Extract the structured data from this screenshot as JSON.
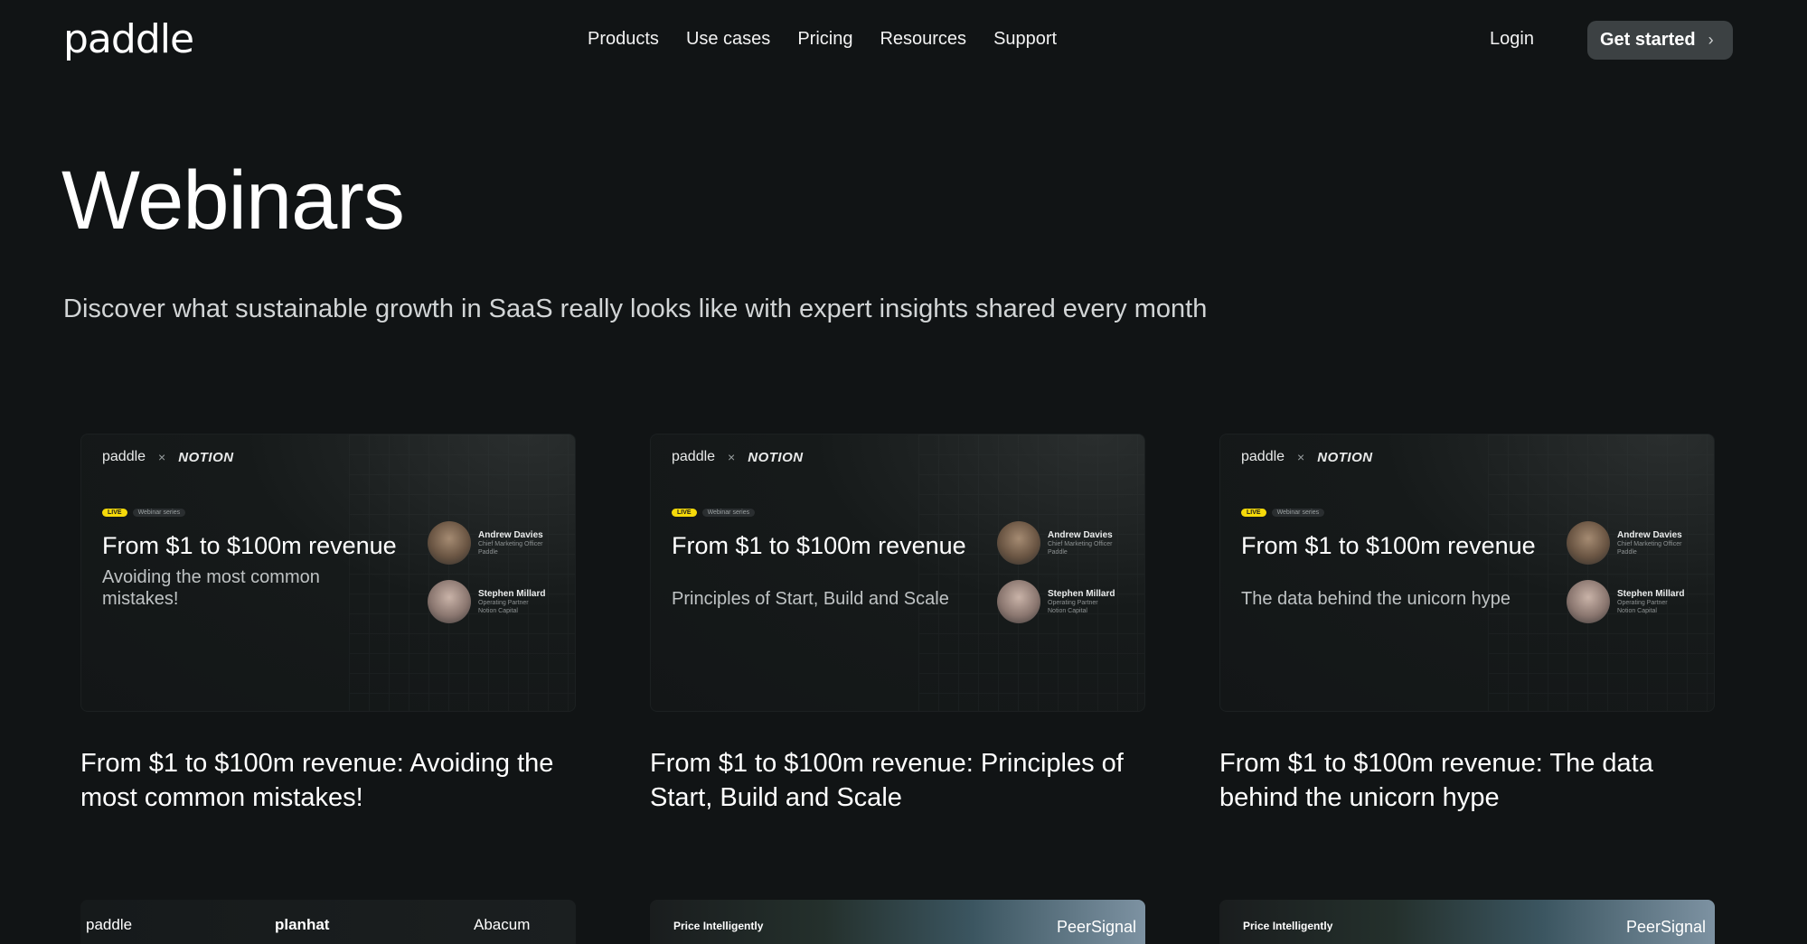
{
  "nav": {
    "logo": "paddle",
    "links": [
      "Products",
      "Use cases",
      "Pricing",
      "Resources",
      "Support"
    ],
    "login": "Login",
    "cta": "Get started"
  },
  "hero": {
    "title": "Webinars",
    "subtitle": "Discover what sustainable growth in SaaS really looks like with expert insights shared every month"
  },
  "cards": [
    {
      "brand_left": "paddle",
      "brand_x": "×",
      "brand_right": "NOTION",
      "live": "LIVE",
      "series": "Webinar series",
      "thumb_title": "From $1 to $100m revenue",
      "thumb_sub": "Avoiding the most common mistakes!",
      "speakers": [
        {
          "name": "Andrew Davies",
          "role": "Chief Marketing Officer",
          "org": "Paddle"
        },
        {
          "name": "Stephen Millard",
          "role": "Operating Partner",
          "org": "Notion Capital"
        }
      ],
      "title": "From $1 to $100m revenue: Avoiding the most common mistakes!"
    },
    {
      "brand_left": "paddle",
      "brand_x": "×",
      "brand_right": "NOTION",
      "live": "LIVE",
      "series": "Webinar series",
      "thumb_title": "From $1 to $100m revenue",
      "thumb_sub": "Principles of Start, Build and Scale",
      "speakers": [
        {
          "name": "Andrew Davies",
          "role": "Chief Marketing Officer",
          "org": "Paddle"
        },
        {
          "name": "Stephen Millard",
          "role": "Operating Partner",
          "org": "Notion Capital"
        }
      ],
      "title": "From $1 to $100m revenue: Principles of Start, Build and Scale"
    },
    {
      "brand_left": "paddle",
      "brand_x": "×",
      "brand_right": "NOTION",
      "live": "LIVE",
      "series": "Webinar series",
      "thumb_title": "From $1 to $100m revenue",
      "thumb_sub": "The data behind the unicorn hype",
      "speakers": [
        {
          "name": "Andrew Davies",
          "role": "Chief Marketing Officer",
          "org": "Paddle"
        },
        {
          "name": "Stephen Millard",
          "role": "Operating Partner",
          "org": "Notion Capital"
        }
      ],
      "title": "From $1 to $100m revenue: The data behind the unicorn hype"
    }
  ],
  "bottom_row": [
    {
      "left": "paddle",
      "mid": "planhat",
      "right": "Abacum"
    },
    {
      "left": "Price Intelligently",
      "right": "PeerSignal"
    },
    {
      "left": "Price Intelligently",
      "right": "PeerSignal"
    }
  ]
}
